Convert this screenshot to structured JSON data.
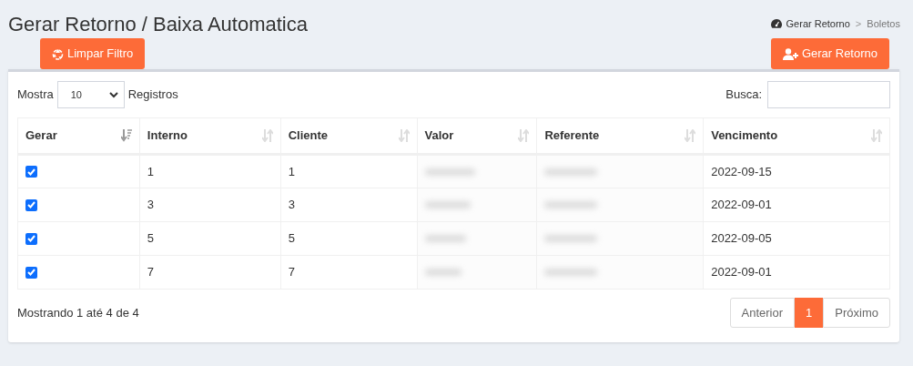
{
  "page_title": "Gerar Retorno / Baixa Automatica",
  "breadcrumb_separator": ">",
  "breadcrumb": [
    {
      "label": "Gerar Retorno",
      "kind": "link"
    },
    {
      "label": "Boletos",
      "kind": "current"
    }
  ],
  "buttons": [
    {
      "label": "Limpar Filtro",
      "kind": "clear"
    },
    {
      "label": "Gerar Retorno",
      "kind": "add-user"
    }
  ],
  "length_control": {
    "before": "Mostra",
    "value": "10",
    "after": "Registros"
  },
  "search": {
    "label": "Busca:"
  },
  "table": {
    "columns": [
      {
        "label": "Gerar",
        "sorted": true
      },
      {
        "label": "Interno",
        "sorted": false
      },
      {
        "label": "Cliente",
        "sorted": false
      },
      {
        "label": "Valor",
        "sorted": false
      },
      {
        "label": "Referente",
        "sorted": false
      },
      {
        "label": "Vencimento",
        "sorted": false
      }
    ],
    "rows": [
      {
        "checked": true,
        "interno": "1",
        "cliente": "1",
        "vencimento": "2022-09-15"
      },
      {
        "checked": true,
        "interno": "3",
        "cliente": "3",
        "vencimento": "2022-09-01"
      },
      {
        "checked": true,
        "interno": "5",
        "cliente": "5",
        "vencimento": "2022-09-05"
      },
      {
        "checked": true,
        "interno": "7",
        "cliente": "7",
        "vencimento": "2022-09-01"
      }
    ]
  },
  "info": "Mostrando 1 até 4 de 4",
  "pagination": [
    {
      "label": "Anterior",
      "selected": false
    },
    {
      "label": "1",
      "selected": true
    },
    {
      "label": "Próximo",
      "selected": false
    }
  ]
}
